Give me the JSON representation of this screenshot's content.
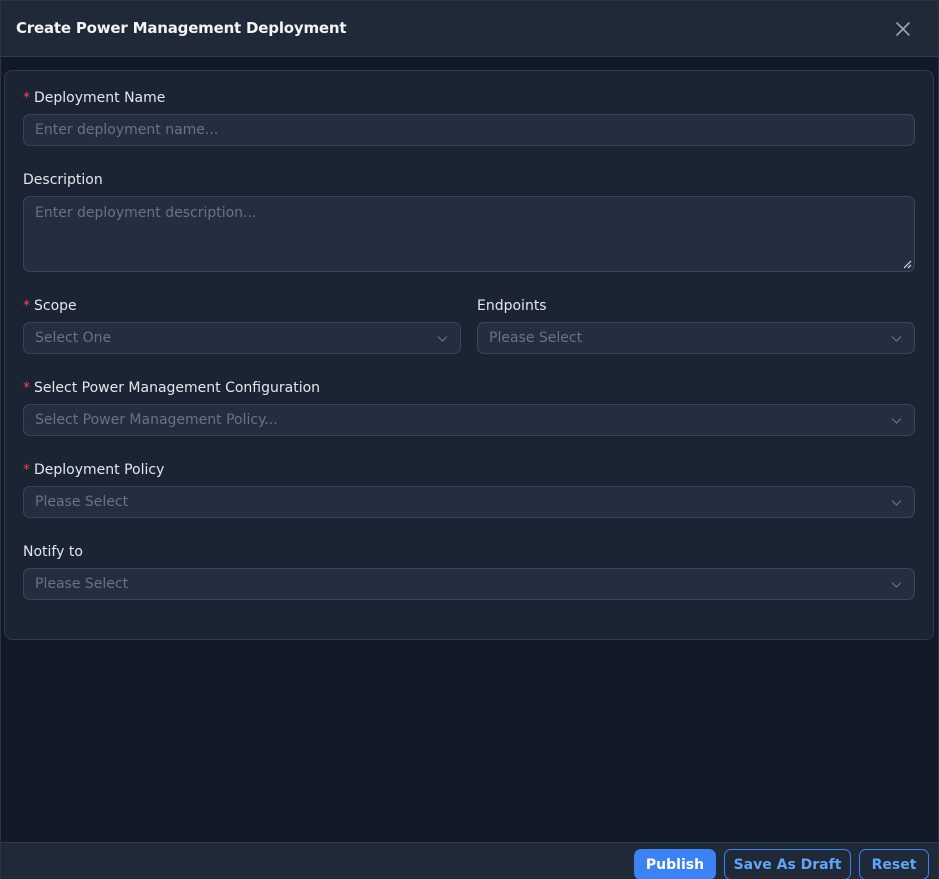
{
  "dialog": {
    "title": "Create Power Management Deployment"
  },
  "form": {
    "deployment_name": {
      "label": "Deployment Name",
      "required_mark": "*",
      "placeholder": "Enter deployment name..."
    },
    "description": {
      "label": "Description",
      "placeholder": "Enter deployment description..."
    },
    "scope": {
      "label": "Scope",
      "required_mark": "*",
      "placeholder": "Select One"
    },
    "endpoints": {
      "label": "Endpoints",
      "placeholder": "Please Select"
    },
    "power_config": {
      "label": "Select Power Management Configuration",
      "required_mark": "*",
      "placeholder": "Select Power Management Policy..."
    },
    "deployment_policy": {
      "label": "Deployment Policy",
      "required_mark": "*",
      "placeholder": "Please Select"
    },
    "notify_to": {
      "label": "Notify to",
      "placeholder": "Please Select"
    }
  },
  "footer": {
    "publish_label": "Publish",
    "save_draft_label": "Save As Draft",
    "reset_label": "Reset"
  },
  "colors": {
    "background": "#111827",
    "panel": "#1b2433",
    "field": "#242e3e",
    "required": "#ef4444",
    "accent": "#3b82f6"
  },
  "icons": {
    "close": "close-icon",
    "dropdown": "chevron-down-icon",
    "resize": "resize-handle-icon"
  }
}
